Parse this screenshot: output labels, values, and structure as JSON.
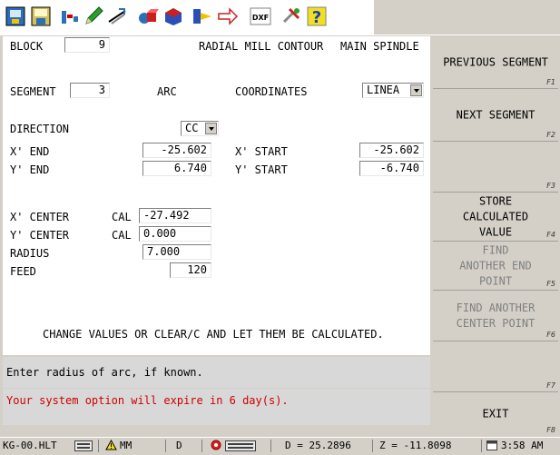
{
  "form": {
    "block_label": "BLOCK",
    "block_value": "9",
    "title": "RADIAL MILL CONTOUR",
    "spindle": "MAIN SPINDLE",
    "segment_label": "SEGMENT",
    "segment_value": "3",
    "segment_type": "ARC",
    "coordinates_label": "COORDINATES",
    "coordinates_value": "LINEA",
    "direction_label": "DIRECTION",
    "direction_value": "CC",
    "x_end_label": "X' END",
    "x_end_value": "-25.602",
    "y_end_label": "Y' END",
    "y_end_value": "6.740",
    "x_start_label": "X' START",
    "x_start_value": "-25.602",
    "y_start_label": "Y' START",
    "y_start_value": "-6.740",
    "x_center_label": "X' CENTER",
    "x_center_cal": "CAL",
    "x_center_value": "-27.492",
    "y_center_label": "Y' CENTER",
    "y_center_cal": "CAL",
    "y_center_value": "0.000",
    "radius_label": "RADIUS",
    "radius_value": "7.000",
    "feed_label": "FEED",
    "feed_value": "120",
    "instruction": "CHANGE VALUES OR CLEAR/C AND LET THEM BE CALCULATED."
  },
  "prompt": "Enter radius of arc, if known.",
  "warning": "Your system option will expire in 6 day(s).",
  "fkeys": [
    {
      "label": "PREVIOUS SEGMENT",
      "fn": "F1",
      "enabled": true
    },
    {
      "label": "NEXT SEGMENT",
      "fn": "F2",
      "enabled": true
    },
    {
      "label": "",
      "fn": "F3",
      "enabled": true
    },
    {
      "label": "STORE CALCULATED VALUE",
      "fn": "F4",
      "enabled": true
    },
    {
      "label": "FIND ANOTHER END POINT",
      "fn": "F5",
      "enabled": false
    },
    {
      "label": "FIND ANOTHER CENTER POINT",
      "fn": "F6",
      "enabled": false
    },
    {
      "label": "",
      "fn": "F7",
      "enabled": true
    },
    {
      "label": "EXIT",
      "fn": "F8",
      "enabled": true
    }
  ],
  "status": {
    "file": "KG-00.HLT",
    "mode": "MM",
    "d_flag": "D",
    "d_readout": "D = 25.2896",
    "z_readout": "Z = -11.8098",
    "time": "3:58 AM"
  },
  "toolbar_icons": [
    "machine-icon",
    "save-icon",
    "tool-icon",
    "pencil-icon",
    "drawing-icon",
    "solid-icon",
    "tool-holder-icon",
    "arrow-icon",
    "dxf-icon",
    "tools-icon",
    "help-icon"
  ],
  "toolbar_labels": {
    "dxf": "DXF"
  },
  "colors": {
    "warning": "#cc0000",
    "panel": "#d4d0c8",
    "form_bg": "#ffffff"
  }
}
